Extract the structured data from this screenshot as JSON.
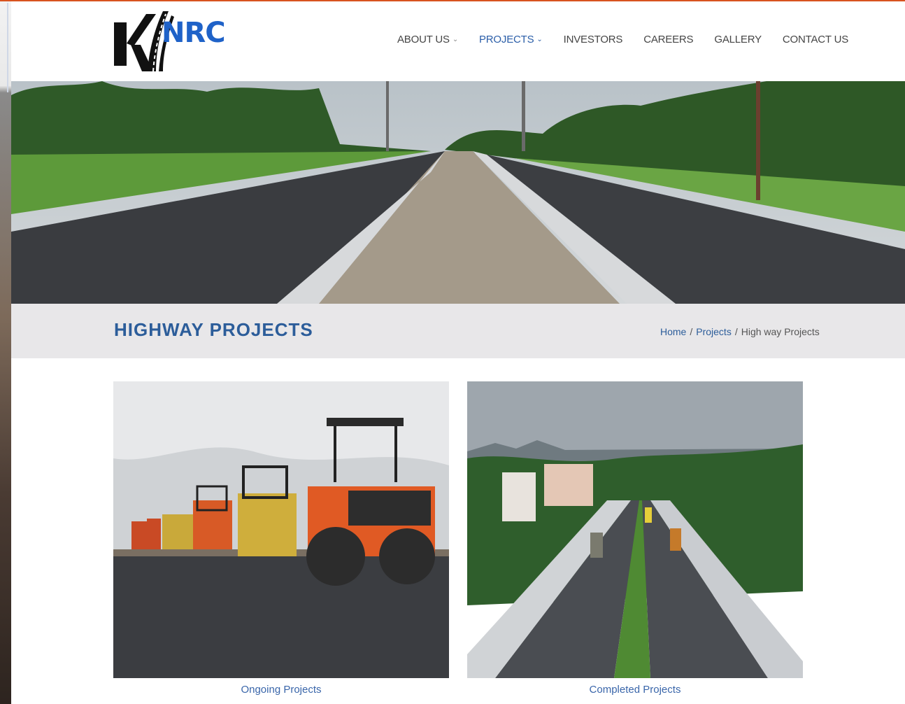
{
  "brand": {
    "logo_text": "NRC",
    "logo_letter": "K"
  },
  "nav": {
    "items": [
      {
        "label": "ABOUT US",
        "has_dropdown": true,
        "active": false
      },
      {
        "label": "PROJECTS",
        "has_dropdown": true,
        "active": true
      },
      {
        "label": "INVESTORS",
        "has_dropdown": false,
        "active": false
      },
      {
        "label": "CAREERS",
        "has_dropdown": false,
        "active": false
      },
      {
        "label": "GALLERY",
        "has_dropdown": false,
        "active": false
      },
      {
        "label": "CONTACT US",
        "has_dropdown": false,
        "active": false
      }
    ]
  },
  "page": {
    "title": "HIGHWAY PROJECTS",
    "breadcrumb": {
      "home": "Home",
      "section": "Projects",
      "current": "High way Projects",
      "separator": "/"
    }
  },
  "cards": [
    {
      "caption": "Ongoing Projects",
      "image": "road-rollers-photo"
    },
    {
      "caption": "Completed Projects",
      "image": "highway-aerial-photo"
    }
  ],
  "colors": {
    "accent": "#d8531f",
    "brand_blue": "#2c5d9a",
    "title_bar": "#e8e7e9"
  }
}
